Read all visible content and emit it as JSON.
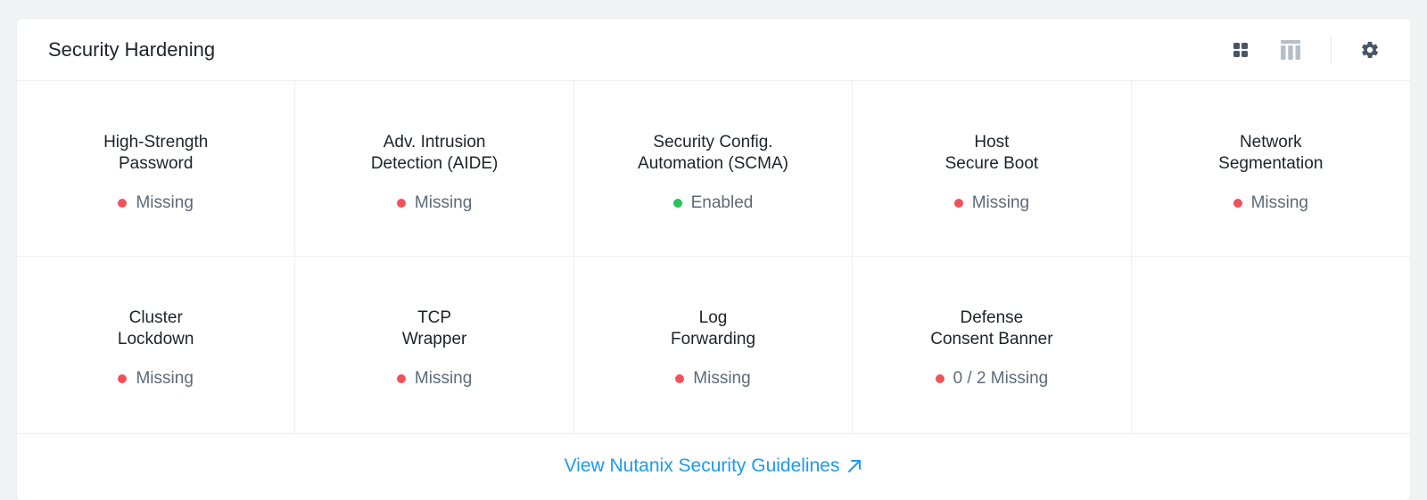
{
  "panel": {
    "title": "Security Hardening"
  },
  "header": {
    "grid_view_icon": "grid-view-icon",
    "table_view_icon": "table-view-icon",
    "settings_icon": "gear-icon"
  },
  "items": [
    {
      "line1": "High-Strength",
      "line2": "Password",
      "status": "Missing",
      "status_color": "#f0525a"
    },
    {
      "line1": "Adv. Intrusion",
      "line2": "Detection (AIDE)",
      "status": "Missing",
      "status_color": "#f0525a"
    },
    {
      "line1": "Security Config.",
      "line2": "Automation (SCMA)",
      "status": "Enabled",
      "status_color": "#27c45a"
    },
    {
      "line1": "Host",
      "line2": "Secure Boot",
      "status": "Missing",
      "status_color": "#f0525a"
    },
    {
      "line1": "Network",
      "line2": "Segmentation",
      "status": "Missing",
      "status_color": "#f0525a"
    },
    {
      "line1": "Cluster",
      "line2": "Lockdown",
      "status": "Missing",
      "status_color": "#f0525a"
    },
    {
      "line1": "TCP",
      "line2": "Wrapper",
      "status": "Missing",
      "status_color": "#f0525a"
    },
    {
      "line1": "Log",
      "line2": "Forwarding",
      "status": "Missing",
      "status_color": "#f0525a"
    },
    {
      "line1": "Defense",
      "line2": "Consent Banner",
      "status": "0 / 2 Missing",
      "status_color": "#f0525a"
    }
  ],
  "footer": {
    "link_label": "View Nutanix Security Guidelines",
    "link_icon": "external-arrow-icon"
  },
  "colors": {
    "link": "#1a9bf0",
    "missing": "#f0525a",
    "enabled": "#27c45a",
    "active_icon": "#4a5463",
    "inactive_icon": "#b7bec8"
  }
}
